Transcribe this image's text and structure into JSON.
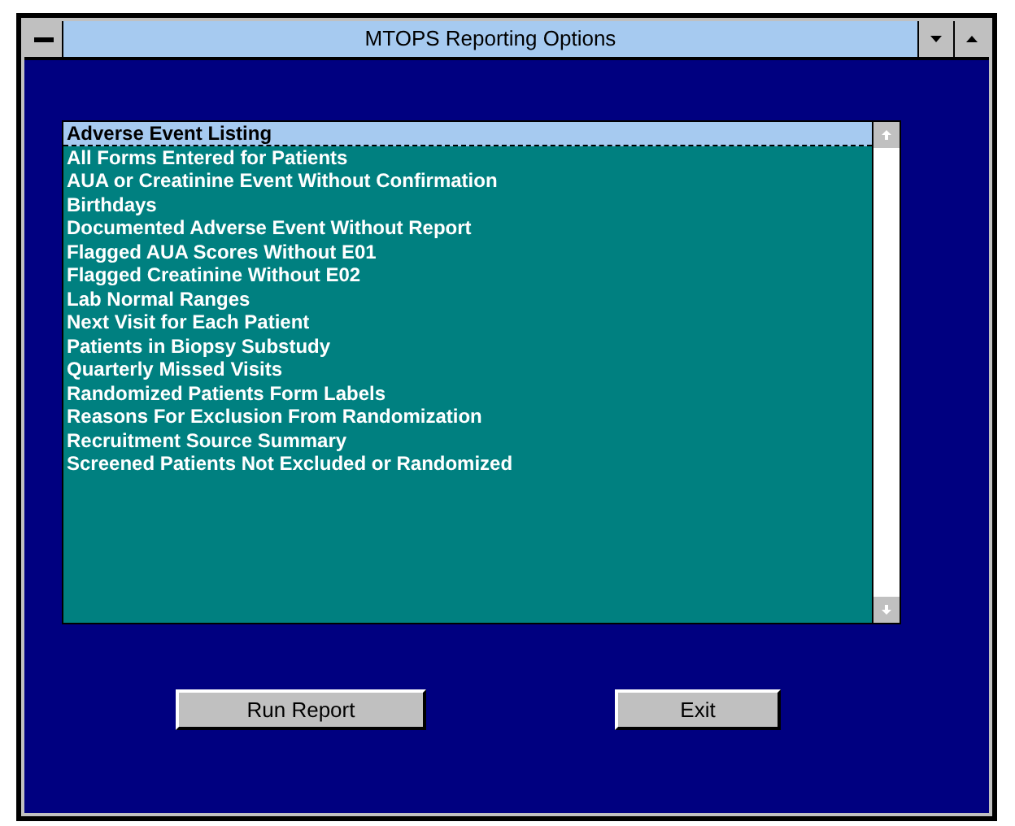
{
  "window": {
    "title": "MTOPS Reporting Options"
  },
  "report_list": {
    "items": [
      {
        "label": "Adverse Event Listing",
        "selected": true
      },
      {
        "label": "All Forms Entered for Patients",
        "selected": false
      },
      {
        "label": "AUA or Creatinine Event Without Confirmation",
        "selected": false
      },
      {
        "label": "Birthdays",
        "selected": false
      },
      {
        "label": "Documented Adverse Event Without Report",
        "selected": false
      },
      {
        "label": "Flagged AUA Scores Without E01",
        "selected": false
      },
      {
        "label": "Flagged Creatinine Without E02",
        "selected": false
      },
      {
        "label": "Lab Normal Ranges",
        "selected": false
      },
      {
        "label": "Next Visit for Each Patient",
        "selected": false
      },
      {
        "label": "Patients in Biopsy Substudy",
        "selected": false
      },
      {
        "label": "Quarterly Missed Visits",
        "selected": false
      },
      {
        "label": "Randomized Patients Form Labels",
        "selected": false
      },
      {
        "label": "Reasons For Exclusion From Randomization",
        "selected": false
      },
      {
        "label": "Recruitment Source Summary",
        "selected": false
      },
      {
        "label": "Screened Patients Not Excluded or Randomized",
        "selected": false
      }
    ]
  },
  "buttons": [
    {
      "label": "Run Report"
    },
    {
      "label": "Exit"
    }
  ]
}
